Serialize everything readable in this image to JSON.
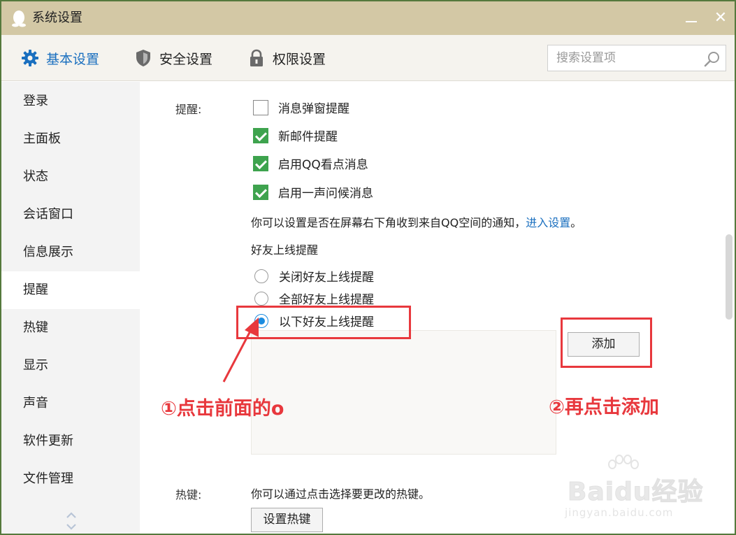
{
  "window": {
    "title": "系统设置",
    "minimize_glyph": "—",
    "close_glyph": "✕"
  },
  "toolbar": {
    "tabs": [
      {
        "label": "基本设置",
        "icon": "gear-icon",
        "active": true
      },
      {
        "label": "安全设置",
        "icon": "shield-icon",
        "active": false
      },
      {
        "label": "权限设置",
        "icon": "lock-icon",
        "active": false
      }
    ],
    "search_placeholder": "搜索设置项"
  },
  "sidebar": {
    "items": [
      {
        "label": "登录"
      },
      {
        "label": "主面板"
      },
      {
        "label": "状态"
      },
      {
        "label": "会话窗口"
      },
      {
        "label": "信息展示"
      },
      {
        "label": "提醒",
        "active": true
      },
      {
        "label": "热键"
      },
      {
        "label": "显示"
      },
      {
        "label": "声音"
      },
      {
        "label": "软件更新"
      },
      {
        "label": "文件管理"
      }
    ]
  },
  "reminder": {
    "label": "提醒:",
    "checkboxes": [
      {
        "label": "消息弹窗提醒",
        "checked": false
      },
      {
        "label": "新邮件提醒",
        "checked": true
      },
      {
        "label": "启用QQ看点消息",
        "checked": true
      },
      {
        "label": "启用一声问候消息",
        "checked": true
      }
    ],
    "qzone_text": "你可以设置是否在屏幕右下角收到来自QQ空间的通知，",
    "qzone_link": "进入设置",
    "qzone_end": "。",
    "friend_title": "好友上线提醒",
    "radios": [
      {
        "label": "关闭好友上线提醒",
        "checked": false
      },
      {
        "label": "全部好友上线提醒",
        "checked": false
      },
      {
        "label": "以下好友上线提醒",
        "checked": true
      }
    ],
    "add_button": "添加"
  },
  "hotkey": {
    "label": "热键:",
    "text": "你可以通过点击选择要更改的热键。",
    "button": "设置热键"
  },
  "annotations": {
    "step1": "①点击前面的o",
    "step2": "②再点击添加",
    "color": "#e8383d"
  },
  "watermark": {
    "brand": "Baidu经验",
    "sub": "jingyan.baidu.com"
  },
  "colors": {
    "accent": "#1a6fbf",
    "checkbox": "#3ea34e",
    "titlebar": "#d3c8a5"
  }
}
